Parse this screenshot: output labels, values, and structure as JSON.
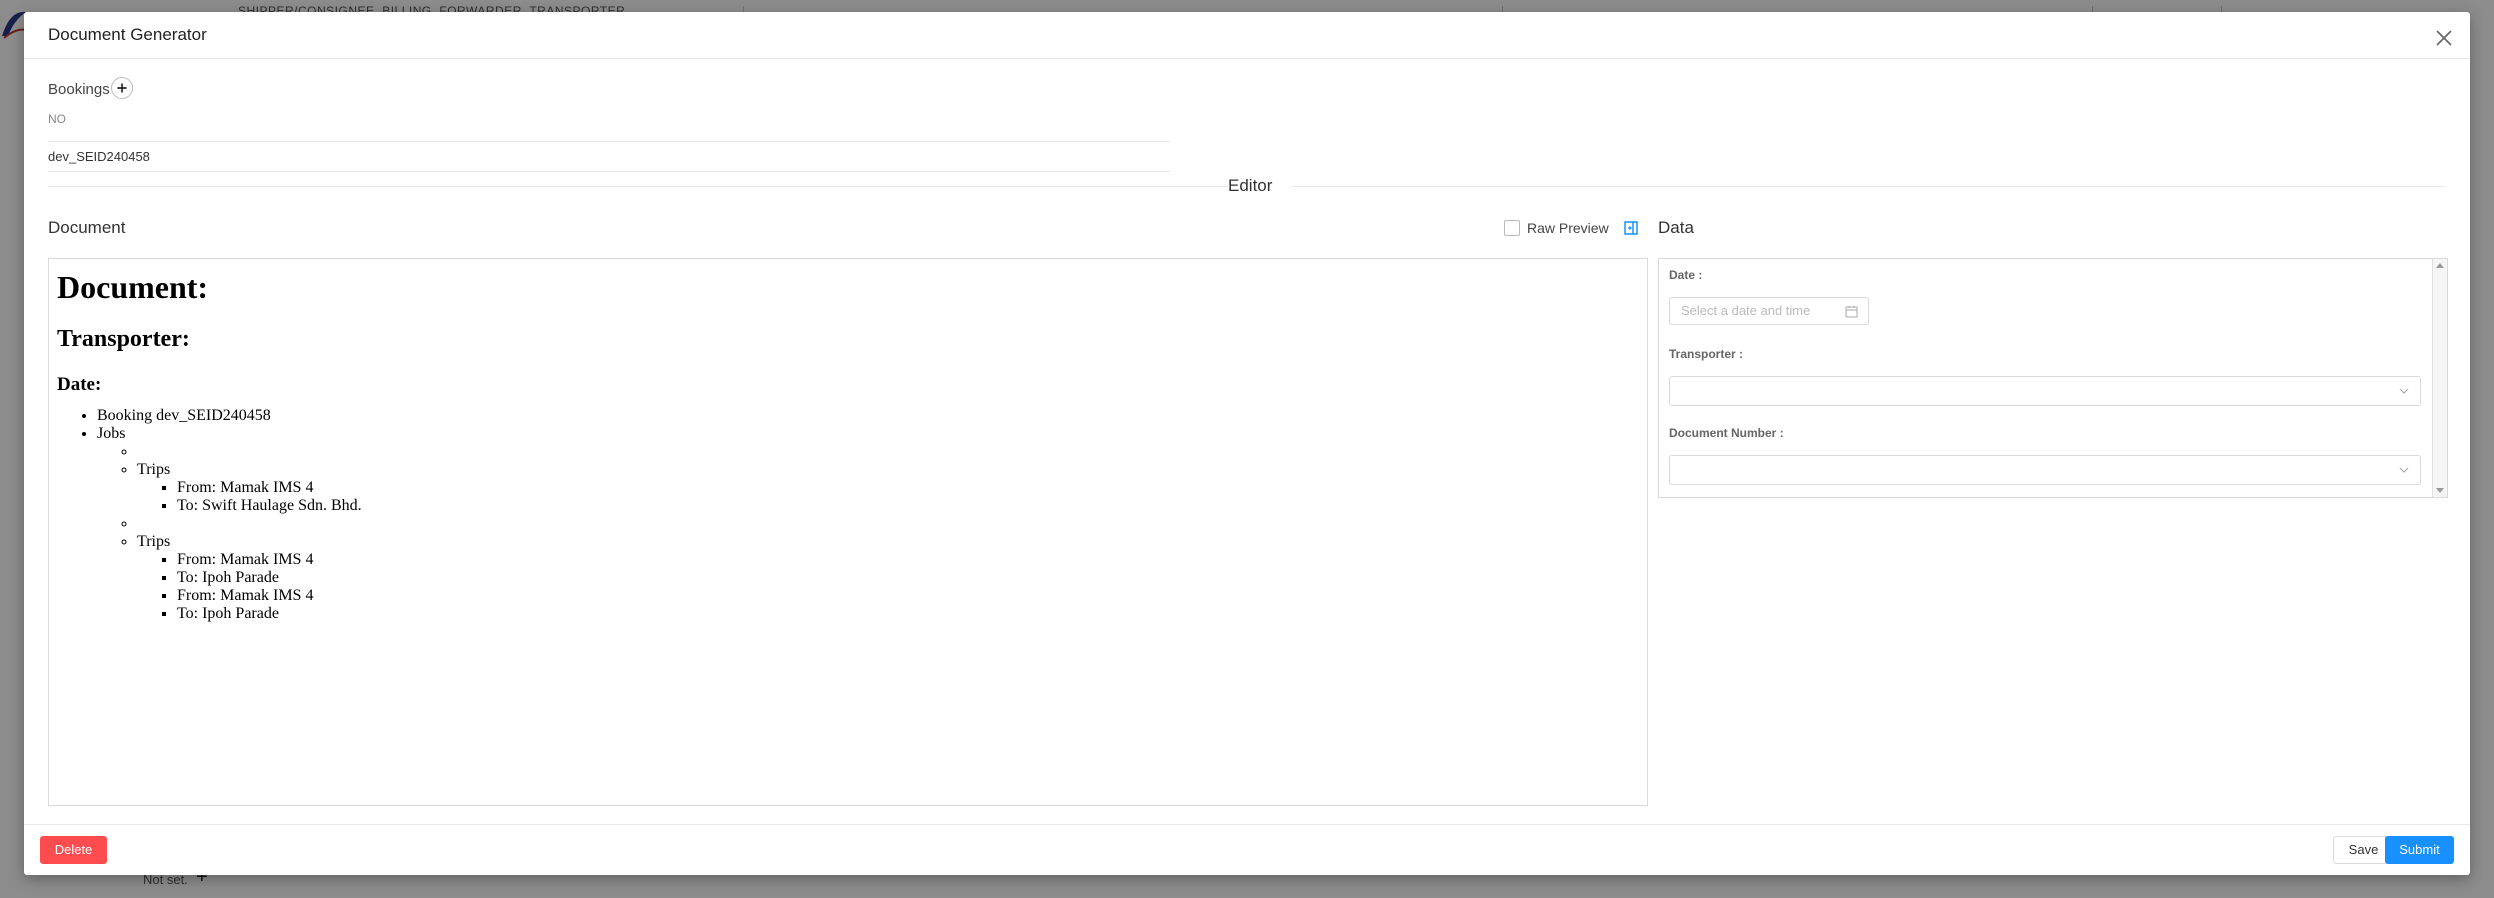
{
  "background": {
    "tabs_text": "SHIPPER/CONSIGNEE, BILLING, FORWARDER, TRANSPORTER",
    "not_set_text": "Not set.",
    "plus": "+"
  },
  "modal": {
    "title": "Document Generator",
    "close_icon": "close-icon"
  },
  "bookings": {
    "label": "Bookings",
    "add_icon": "plus-icon",
    "column_header": "NO",
    "rows": [
      "dev_SEID240458"
    ]
  },
  "editor": {
    "divider_title": "Editor",
    "document_title": "Document",
    "raw_preview_label": "Raw Preview",
    "raw_preview_checked": false,
    "data_title": "Data"
  },
  "document": {
    "h1": "Document:",
    "h2": "Transporter:",
    "h3": "Date:",
    "booking_item": "Booking dev_SEID240458",
    "jobs_label": "Jobs",
    "jobs": [
      {
        "label": "",
        "trips_label": "Trips",
        "trips": [
          "From: Mamak IMS 4",
          "To: Swift Haulage Sdn. Bhd."
        ]
      },
      {
        "label": "",
        "trips_label": "Trips",
        "trips": [
          "From: Mamak IMS 4",
          "To: Ipoh Parade",
          "From: Mamak IMS 4",
          "To: Ipoh Parade"
        ]
      }
    ]
  },
  "data_form": {
    "date_label": "Date",
    "date_placeholder": "Select a date and time",
    "transporter_label": "Transporter",
    "document_number_label": "Document Number",
    "colon": ":"
  },
  "footer": {
    "delete_label": "Delete",
    "save_label": "Save",
    "submit_label": "Submit"
  },
  "colors": {
    "primary": "#1890ff",
    "danger": "#ff4d4f",
    "border": "#d9d9d9"
  }
}
